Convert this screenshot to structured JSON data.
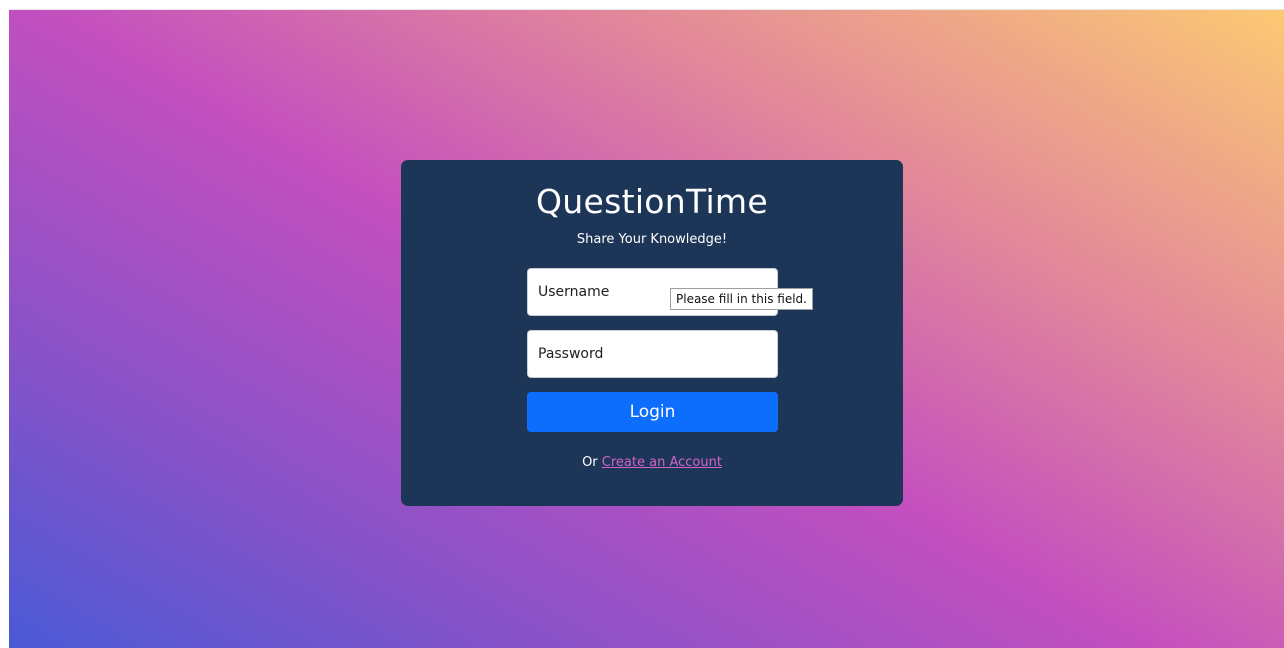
{
  "app": {
    "title": "QuestionTime",
    "subtitle": "Share Your Knowledge!"
  },
  "form": {
    "username_placeholder": "Username",
    "password_placeholder": "Password",
    "username_value": "",
    "password_value": "",
    "login_label": "Login",
    "validation_tooltip": "Please fill in this field."
  },
  "signup": {
    "prefix": "Or",
    "link_label": "Create an Account"
  },
  "colors": {
    "card_background": "#1d3557",
    "login_button": "#0d6efd",
    "link": "#d264c8"
  }
}
